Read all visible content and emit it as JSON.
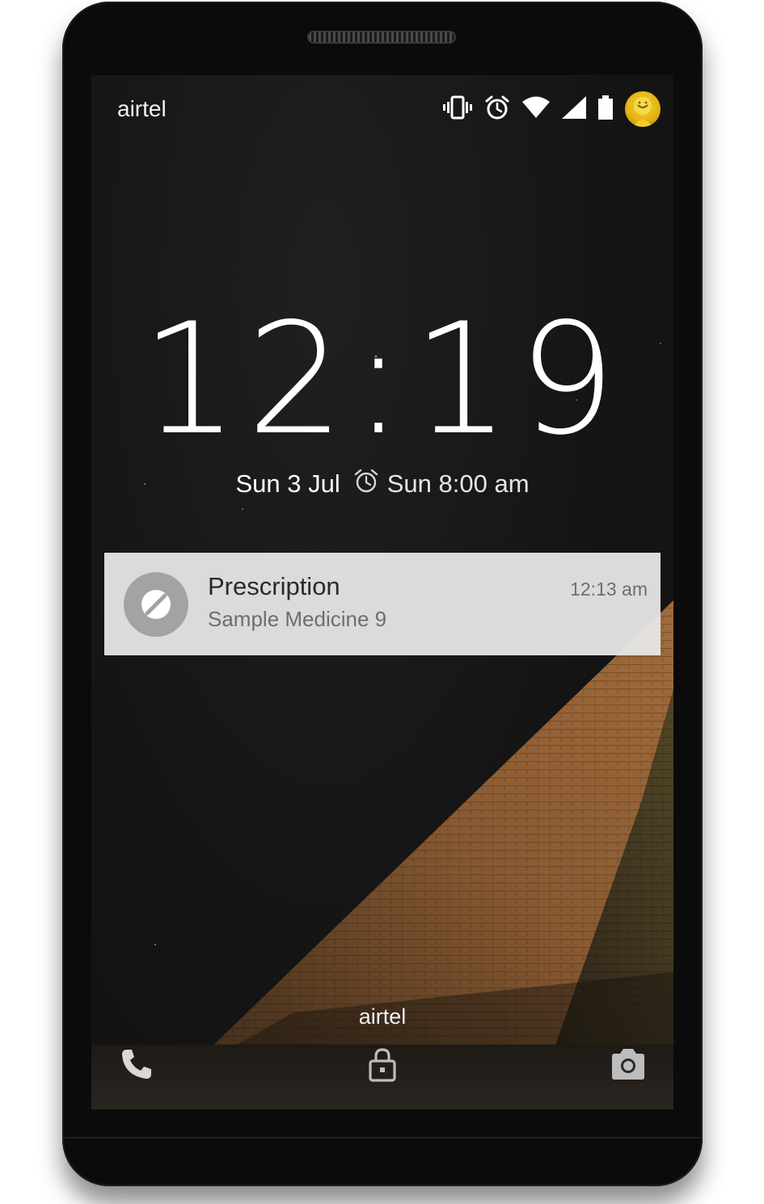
{
  "status_bar": {
    "carrier": "airtel",
    "icons": [
      "vibrate-icon",
      "alarm-icon",
      "wifi-icon",
      "signal-icon",
      "battery-icon",
      "avatar"
    ]
  },
  "lockscreen": {
    "time": "12:19",
    "date": "Sun 3 Jul",
    "next_alarm": "Sun 8:00 am"
  },
  "notification": {
    "icon": "no-entry-icon",
    "title": "Prescription",
    "text": "Sample Medicine 9",
    "time": "12:13 am"
  },
  "bottom": {
    "carrier": "airtel",
    "left_icon": "phone-icon",
    "center_icon": "lock-icon",
    "right_icon": "camera-icon"
  },
  "colors": {
    "screen_bg": "#151515",
    "notification_bg": "#e8e8e8",
    "pyramid": "#a8703a"
  }
}
